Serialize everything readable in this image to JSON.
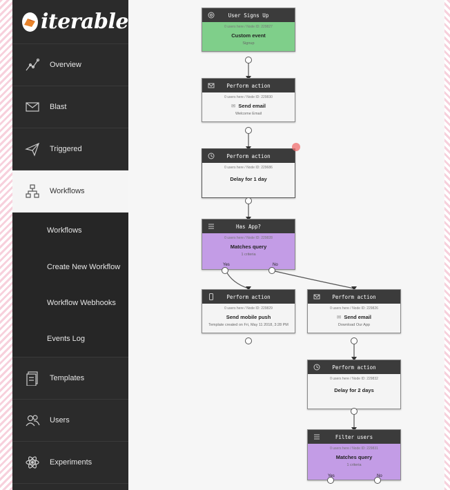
{
  "brand": {
    "name": "iterable",
    "mark_color": "#e8842c"
  },
  "sidebar": {
    "items": [
      {
        "label": "Overview",
        "icon": "line-chart-icon"
      },
      {
        "label": "Blast",
        "icon": "envelope-icon"
      },
      {
        "label": "Triggered",
        "icon": "paper-plane-icon"
      },
      {
        "label": "Workflows",
        "icon": "hierarchy-icon",
        "active": true
      }
    ],
    "sub_items": [
      {
        "label": "Workflows"
      },
      {
        "label": "Create New Workflow"
      },
      {
        "label": "Workflow Webhooks"
      },
      {
        "label": "Events Log"
      }
    ],
    "items_after": [
      {
        "label": "Templates",
        "icon": "document-icon"
      },
      {
        "label": "Users",
        "icon": "users-icon"
      },
      {
        "label": "Experiments",
        "icon": "atom-icon"
      }
    ]
  },
  "workflow": {
    "nodes": {
      "signup": {
        "title": "User Signs Up",
        "meta": "0 users here / Node ID: 229827",
        "main": "Custom event",
        "sub": "Signup",
        "color": "#7fcf8a"
      },
      "send_welcome": {
        "title": "Perform action",
        "meta": "0 users here / Node ID: 229830",
        "main": "Send email",
        "sub": "Welcome Email"
      },
      "delay1": {
        "title": "Perform action",
        "meta": "0 users here / Node ID: 229686",
        "main": "Delay for 1 day"
      },
      "has_app": {
        "title": "Has App?",
        "meta": "0 users here / Node ID: 229828",
        "main": "Matches query",
        "sub": "1 criteria",
        "yes": "Yes",
        "no": "No",
        "color": "#c39ce6"
      },
      "push": {
        "title": "Perform action",
        "meta": "0 users here / Node ID: 229829",
        "main": "Send mobile push",
        "sub": "Template created on Fri, May 11 2018, 3:28 PM"
      },
      "send_download": {
        "title": "Perform action",
        "meta": "0 users here / Node ID: 229826",
        "main": "Send email",
        "sub": "Download Our App"
      },
      "delay2": {
        "title": "Perform action",
        "meta": "0 users here / Node ID: 229832",
        "main": "Delay for 2 days"
      },
      "filter": {
        "title": "Filter users",
        "meta": "0 users here / Node ID: 229831",
        "main": "Matches query",
        "sub": "1 criteria",
        "yes": "Yes",
        "no": "No",
        "color": "#c39ce6"
      }
    }
  }
}
